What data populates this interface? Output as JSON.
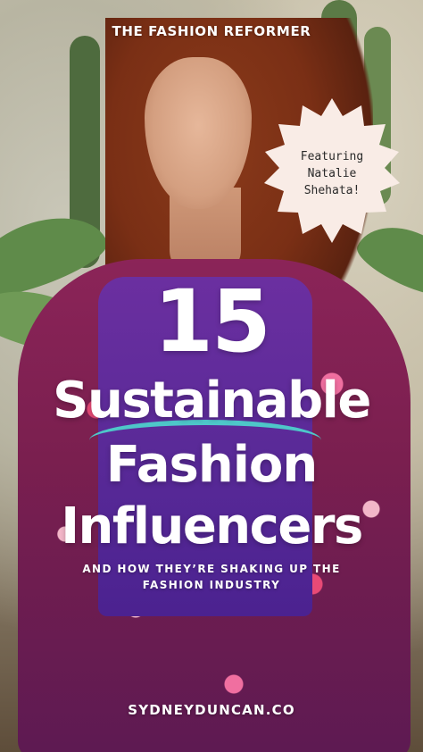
{
  "brand": "THE FASHION REFORMER",
  "badge": {
    "line1": "Featuring",
    "line2": "Natalie",
    "line3": "Shehata!",
    "color": "#f9ece6"
  },
  "headline": {
    "number": "15",
    "line1": "Sustainable",
    "line2": "Fashion",
    "line3": "Influencers"
  },
  "subtitle": {
    "line1": "AND HOW THEY’RE SHAKING UP THE",
    "line2": "FASHION INDUSTRY"
  },
  "website": "SYDNEYDUNCAN.CO"
}
